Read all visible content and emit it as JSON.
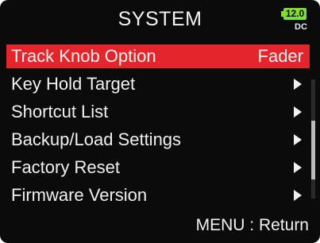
{
  "header": {
    "title": "SYSTEM",
    "battery_level": "12.0",
    "power_source": "DC",
    "battery_color": "#7fdc3a"
  },
  "menu": {
    "items": [
      {
        "label": "Track Knob Option",
        "value": "Fader",
        "selected": true
      },
      {
        "label": "Key Hold Target",
        "icon": "chevron-right-icon"
      },
      {
        "label": "Shortcut List",
        "icon": "chevron-right-icon"
      },
      {
        "label": "Backup/Load Settings",
        "icon": "chevron-right-icon"
      },
      {
        "label": "Factory Reset",
        "icon": "chevron-right-icon"
      },
      {
        "label": "Firmware Version",
        "icon": "chevron-right-icon"
      }
    ]
  },
  "footer": {
    "hint": "MENU : Return"
  },
  "colors": {
    "highlight": "#e2262c",
    "background": "#0b0b0b",
    "text": "#f0f0f0"
  }
}
